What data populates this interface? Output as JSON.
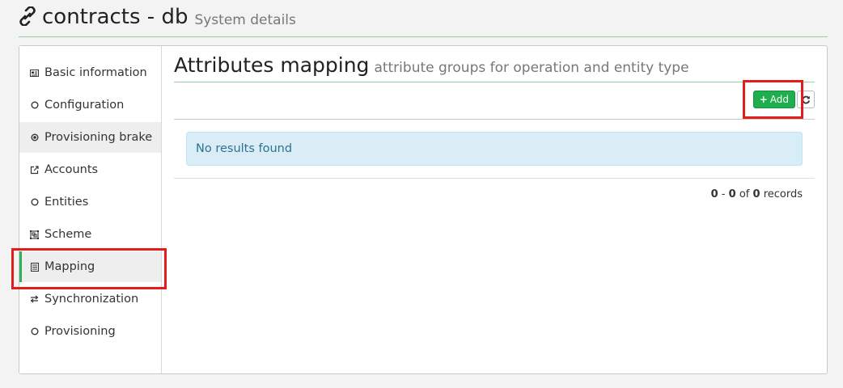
{
  "header": {
    "title": "contracts - db",
    "subtitle": "System details",
    "icon": "link-icon"
  },
  "sidebar": {
    "items": [
      {
        "label": "Basic information",
        "icon": "id-card-icon",
        "state": "normal"
      },
      {
        "label": "Configuration",
        "icon": "circle-outline-icon",
        "state": "normal"
      },
      {
        "label": "Provisioning brake",
        "icon": "dot-circle-icon",
        "state": "shaded"
      },
      {
        "label": "Accounts",
        "icon": "external-link-icon",
        "state": "normal"
      },
      {
        "label": "Entities",
        "icon": "circle-outline-icon",
        "state": "normal"
      },
      {
        "label": "Scheme",
        "icon": "object-group-icon",
        "state": "normal"
      },
      {
        "label": "Mapping",
        "icon": "list-alt-icon",
        "state": "active"
      },
      {
        "label": "Synchronization",
        "icon": "exchange-icon",
        "state": "normal"
      },
      {
        "label": "Provisioning",
        "icon": "circle-outline-icon",
        "state": "normal"
      }
    ]
  },
  "content": {
    "title": "Attributes mapping",
    "subtitle": "attribute groups for operation and entity type",
    "add_label": "Add",
    "empty_message": "No results found",
    "pagination": {
      "from": "0",
      "sep": "-",
      "to": "0",
      "of": "of",
      "total": "0",
      "unit": "records"
    }
  },
  "colors": {
    "accent_green": "#1fae4e",
    "active_border": "#2bb25a",
    "header_rule": "#9ad1a4",
    "alert_bg": "#d9edf7",
    "alert_text": "#31708f",
    "highlight": "#e31c1c"
  }
}
